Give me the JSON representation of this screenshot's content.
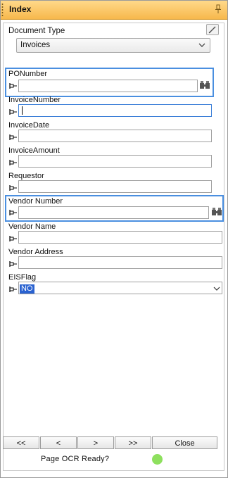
{
  "panel": {
    "title": "Index",
    "pin_icon": "pin-icon"
  },
  "document_type": {
    "label": "Document Type",
    "value": "Invoices",
    "edit_icon": "pencil-icon"
  },
  "fields": {
    "po_number": {
      "label": "PONumber",
      "value": ""
    },
    "invoice_number": {
      "label": "InvoiceNumber",
      "value": ""
    },
    "invoice_date": {
      "label": "InvoiceDate",
      "value": ""
    },
    "invoice_amount": {
      "label": "InvoiceAmount",
      "value": ""
    },
    "requestor": {
      "label": "Requestor",
      "value": ""
    },
    "vendor_number": {
      "label": "Vendor Number",
      "value": ""
    },
    "vendor_name": {
      "label": "Vendor Name",
      "value": ""
    },
    "vendor_address": {
      "label": "Vendor Address",
      "value": ""
    },
    "eis_flag": {
      "label": "EISFlag",
      "value": "NO"
    }
  },
  "navigation": {
    "first": "<<",
    "prev": "<",
    "next": ">",
    "last": ">>",
    "close": "Close"
  },
  "status": {
    "text": "Page OCR Ready?",
    "indicator_color": "#8ee05e"
  },
  "colors": {
    "title_bar": "#f7b84c",
    "highlight": "#4a8fe0"
  }
}
